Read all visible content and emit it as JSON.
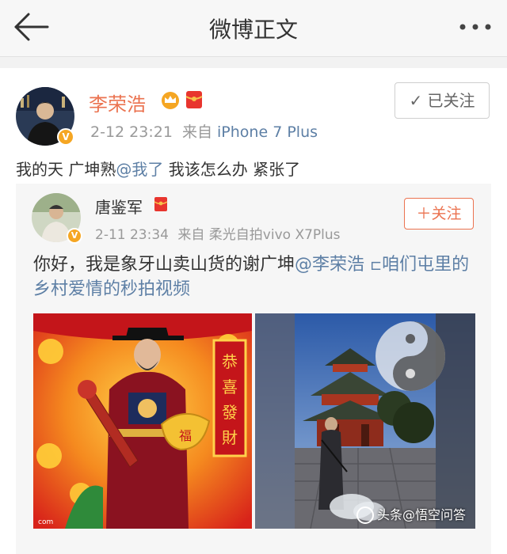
{
  "nav": {
    "title": "微博正文",
    "back_icon": "back-arrow-icon",
    "more_icon": "more-dots-icon"
  },
  "post": {
    "author": "李荣浩",
    "time": "2-12 23:21",
    "source_prefix": "来自",
    "source": "iPhone 7 Plus",
    "follow_label": "✓ 已关注",
    "text_part1": "我的天 广坤熟",
    "text_mention": "@我了",
    "text_part2": " 我该怎么办 紧张了"
  },
  "repost": {
    "author": "唐鉴军",
    "time": "2-11 23:34",
    "source_prefix": "来自",
    "source": "柔光自拍vivo X7Plus",
    "follow_label": "＋关注",
    "text_part1": "你好，我是象牙山卖山货的谢广坤",
    "text_mention": "@李荣浩",
    "text_video_icon": "⊏",
    "text_video": "咱们屯里的乡村爱情的秒拍视频"
  },
  "watermark": "头条@悟空问答",
  "colors": {
    "accent_orange": "#eb7350",
    "link_blue": "#5d7fa5",
    "vip_gold": "#f5a623",
    "redpacket": "#e8352e"
  }
}
